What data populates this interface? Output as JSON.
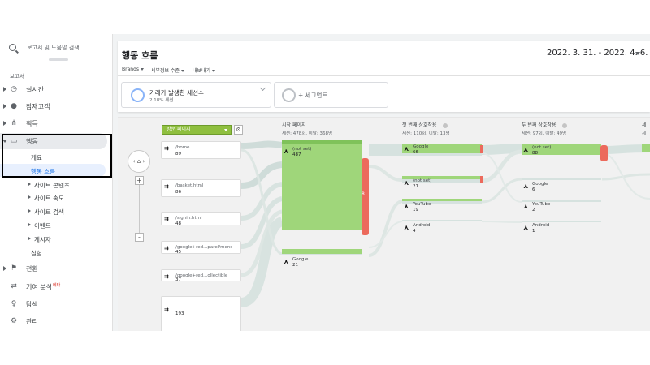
{
  "search": {
    "placeholder": "보고서 및 도움말 검색"
  },
  "sidebar": {
    "section_label": "보고서",
    "items": [
      {
        "label": "실시간",
        "icon": "clock-icon"
      },
      {
        "label": "잠재고객",
        "icon": "person-icon"
      },
      {
        "label": "획득",
        "icon": "acquisition-icon"
      },
      {
        "label": "행동",
        "icon": "behavior-icon"
      }
    ],
    "behavior_sub": [
      {
        "label": "개요"
      },
      {
        "label": "행동 흐름"
      }
    ],
    "behavior_groups": [
      {
        "label": "사이트 콘텐츠"
      },
      {
        "label": "사이트 속도"
      },
      {
        "label": "사이트 검색"
      },
      {
        "label": "이벤트"
      },
      {
        "label": "게시자"
      }
    ],
    "experiments": "실험",
    "bottom": [
      {
        "label": "전환",
        "icon": "flag-icon"
      },
      {
        "label": "기여 분석",
        "badge": "베타",
        "icon": "attribution-icon"
      },
      {
        "label": "탐색",
        "icon": "lightbulb-icon"
      },
      {
        "label": "관리",
        "icon": "gear-icon"
      }
    ]
  },
  "header": {
    "title": "행동 흐름",
    "date_range": "2022. 3. 31. - 2022. 4. 6.",
    "toolbar": [
      "Brands",
      "세부정보 수준",
      "내보내기"
    ]
  },
  "segments": [
    {
      "name": "거래가 발생한 세션수",
      "pct": "2.18% 세션"
    },
    {
      "name": "+ 세그먼트"
    }
  ],
  "flow": {
    "dimension_select": "방문 페이지",
    "nav_label": "‹ ⌂ ›",
    "zoom_in": "+",
    "zoom_out": "-",
    "columns": [
      {
        "title": "시작 페이지",
        "stats": "세션: 478회, 이탈: 368명"
      },
      {
        "title": "첫 번째 상호작용",
        "stats": "세션: 110회, 이탈: 13명"
      },
      {
        "title": "두 번째 상호작용",
        "stats": "세션: 97회, 이탈: 49명"
      },
      {
        "title": "세",
        "stats": "세"
      }
    ],
    "landing_pages": [
      {
        "name": "/home",
        "value": "89"
      },
      {
        "name": "/basket.html",
        "value": "86"
      },
      {
        "name": "/signin.html",
        "value": "48"
      },
      {
        "name": "/google+red...parel/mens",
        "value": "45"
      },
      {
        "name": "/google+red...ollectible",
        "value": "37"
      },
      {
        "name": "",
        "value": "193"
      }
    ],
    "start_nodes": [
      {
        "name": "(not set)",
        "value": "487"
      },
      {
        "name": "Google",
        "value": "21"
      }
    ],
    "first_nodes": [
      {
        "name": "Google",
        "value": "66"
      },
      {
        "name": "(not set)",
        "value": "21"
      },
      {
        "name": "YouTube",
        "value": "19"
      },
      {
        "name": "Android",
        "value": "4"
      }
    ],
    "second_nodes": [
      {
        "name": "(not set)",
        "value": "88"
      },
      {
        "name": "Google",
        "value": "6"
      },
      {
        "name": "YouTube",
        "value": "2"
      },
      {
        "name": "Android",
        "value": "1"
      }
    ],
    "dropoff_label": "8"
  }
}
